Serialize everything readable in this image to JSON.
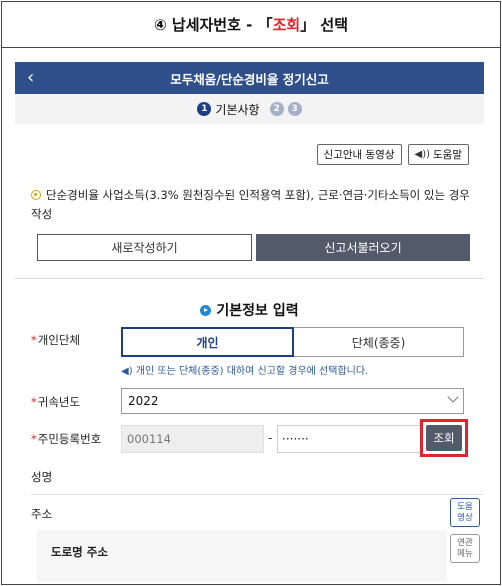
{
  "caption": {
    "prefix": "④ 납세자번호 - 「",
    "highlight": "조회",
    "suffix": "」 선택"
  },
  "topbar": {
    "back_glyph": "‹",
    "title": "모두채움/단순경비율 정기신고"
  },
  "steps": [
    {
      "num": "1",
      "label": "기본사항",
      "active": true
    },
    {
      "num": "2",
      "active": false
    },
    {
      "num": "3",
      "active": false
    }
  ],
  "guide_buttons": {
    "video": "신고안내 동영상",
    "help_icon": "speaker-icon",
    "help": "도움말"
  },
  "notice": "단순경비율 사업소득(3.3% 원천징수된 인적용역 포함), 근로·연금·기타소득이 있는 경우 작성",
  "actions": {
    "new": "새로작성하기",
    "load": "신고서불러오기"
  },
  "section_title": "기본정보 입력",
  "form": {
    "type_label": "개인단체",
    "type_options": [
      "개인",
      "단체(종중)"
    ],
    "type_selected": "개인",
    "type_hint": "개인 또는 단체(종중) 대하여 신고할 경우에 선택합니다.",
    "year_label": "귀속년도",
    "year_value": "2022",
    "rrn_label": "주민등록번호",
    "rrn_front": "000114",
    "rrn_dash": "-",
    "rrn_back": "·······",
    "lookup_button": "조회",
    "name_label": "성명",
    "address_label": "주소",
    "road_address_label": "도로명 주소"
  },
  "side_buttons": {
    "help_video": [
      "도움",
      "영상"
    ],
    "related_menu": [
      "연관",
      "메뉴"
    ]
  },
  "colors": {
    "primary": "#2f4f8b",
    "highlight": "#e3242b",
    "dark_button": "#535b6b",
    "hint_blue": "#2c5aa0"
  }
}
